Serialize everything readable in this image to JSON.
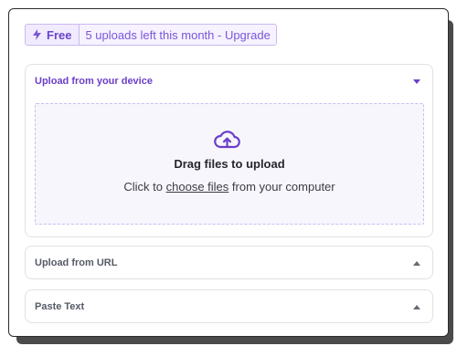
{
  "plan": {
    "badge_label": "Free",
    "badge_icon": "bolt-icon",
    "uploads_text": "5 uploads left this month - Upgrade"
  },
  "sections": {
    "device": {
      "title": "Upload from your device",
      "state": "expanded",
      "dropzone": {
        "icon": "cloud-upload-icon",
        "title": "Drag files to upload",
        "sub_prefix": "Click to",
        "sub_link": "choose files",
        "sub_suffix": "from your computer"
      }
    },
    "url": {
      "title": "Upload from URL",
      "state": "collapsed"
    },
    "paste": {
      "title": "Paste Text",
      "state": "collapsed"
    }
  },
  "colors": {
    "accent": "#6b3fc9",
    "badge_bg": "#f1ebff",
    "dropzone_bg": "#f8f6fd",
    "dropzone_border": "#c9bdf0"
  }
}
